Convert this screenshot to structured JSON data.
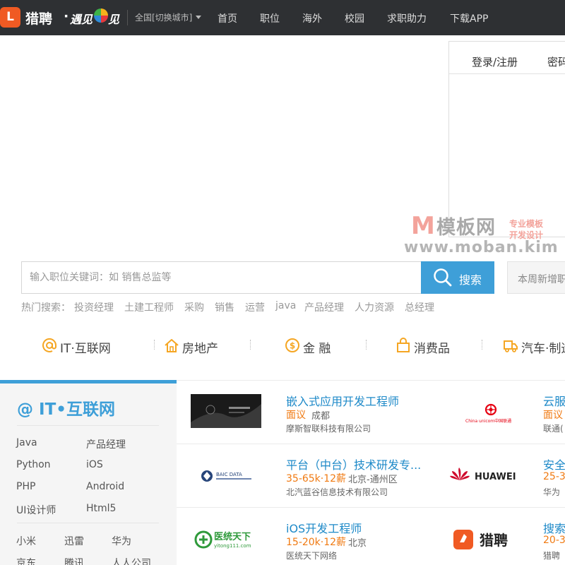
{
  "header": {
    "logo_mark": "L",
    "logo_text": "猎聘",
    "logo_dot": "·",
    "slogan_1": "遇见",
    "slogan_2": "见",
    "city": "全国[切换城市]",
    "nav": [
      "首页",
      "职位",
      "海外",
      "校园",
      "求职助力",
      "下载APP"
    ]
  },
  "login": {
    "tab_login": "登录/注册",
    "tab_password": "密码"
  },
  "watermark": {
    "mark": "M",
    "name": "模板网",
    "side_1": "专业模板",
    "side_2": "开发设计",
    "url": "www.moban.kim"
  },
  "search": {
    "placeholder": "输入职位关键词：如 销售总监等",
    "button": "搜索",
    "weekly": "本周新增职位"
  },
  "hot": {
    "label": "热门搜索：",
    "items": [
      "投资经理",
      "土建工程师",
      "采购",
      "销售",
      "运营",
      "java",
      "产品经理",
      "人力资源",
      "总经理"
    ]
  },
  "categories": [
    {
      "label": "IT·互联网",
      "icon": "at-icon"
    },
    {
      "label": "房地产",
      "icon": "house-icon"
    },
    {
      "label": "金 融",
      "icon": "coin-icon"
    },
    {
      "label": "消费品",
      "icon": "bag-icon"
    },
    {
      "label": "汽车·制造",
      "icon": "truck-icon"
    }
  ],
  "sidebar": {
    "title": "@ IT•互联网",
    "jobs": [
      "Java",
      "产品经理",
      "Python",
      "iOS",
      "PHP",
      "Android",
      "UI设计师",
      "Html5"
    ],
    "companies": [
      "小米",
      "迅雷",
      "华为",
      "京东",
      "腾讯",
      "人人公司"
    ]
  },
  "jobs_left": [
    {
      "title": "嵌入式应用开发工程师",
      "salary": "面议",
      "location": "成都",
      "company": "摩斯智联科技有限公司",
      "logo": "dark-car-logo"
    },
    {
      "title": "平台（中台）技术研发专...",
      "salary": "35-65k·12薪",
      "location": "北京-通州区",
      "company": "北汽蓝谷信息技术有限公司",
      "logo": "baic-data-logo",
      "logo_text": "BAIC DATA"
    },
    {
      "title": "iOS开发工程师",
      "salary": "15-20k·12薪",
      "location": "北京",
      "company": "医统天下网络",
      "logo": "yitong-logo",
      "logo_text": "医统天下",
      "logo_sub": "yitong111.com"
    }
  ],
  "jobs_right": [
    {
      "title": "云服",
      "salary": "面议",
      "company": "联通(",
      "logo": "china-unicom-logo",
      "logo_text": "China unicom中国联通"
    },
    {
      "title": "安全",
      "salary": "25-3",
      "company": "华为",
      "logo": "huawei-logo",
      "logo_text": "HUAWEI"
    },
    {
      "title": "搜索",
      "salary": "20-3",
      "company": "猎聘",
      "logo": "liepin-logo",
      "logo_text": "猎聘"
    }
  ],
  "colors": {
    "topbar": "#2e3033",
    "accent": "#3e9fd8",
    "brand": "#f05a23",
    "salary": "#f07a12",
    "link": "#1d89c8"
  }
}
